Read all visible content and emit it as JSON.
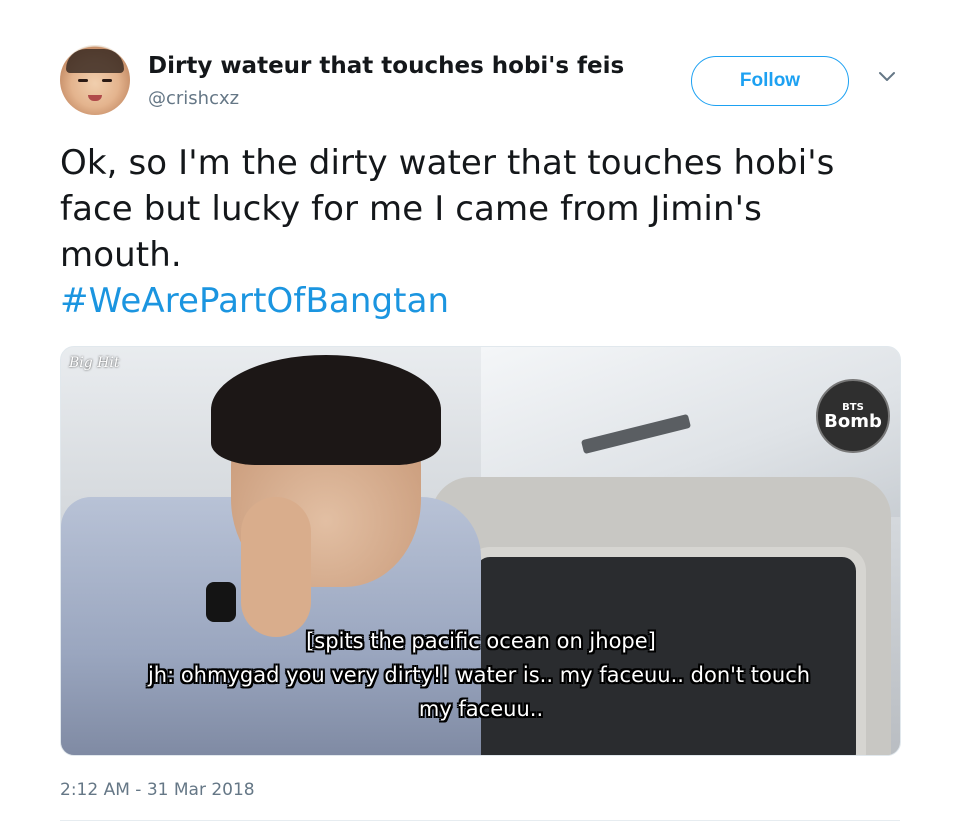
{
  "user": {
    "display_name": "Dirty wateur that touches hobi's feis",
    "handle": "@crishcxz"
  },
  "actions": {
    "follow_label": "Follow"
  },
  "tweet": {
    "text_lines": [
      "Ok, so I'm the dirty water that touches hobi's",
      "face but lucky for me I came from Jimin's",
      "mouth."
    ],
    "hashtag": "#WeArePartOfBangtan",
    "timestamp": "2:12 AM - 31 Mar 2018"
  },
  "media": {
    "watermark_left": "Big Hit",
    "watermark_right_top": "BTS",
    "watermark_right_bottom": "Bomb",
    "caption_lines": [
      "[spits the pacific ocean on jhope]",
      "jh: ohmygad you very dirty!! water is.. my faceuu.. don't touch",
      "my faceuu.."
    ]
  },
  "colors": {
    "accent": "#1da1f2",
    "hashtag": "#1b95e0",
    "secondary_text": "#657786"
  },
  "icons": {
    "caret": "chevron-down-icon"
  }
}
